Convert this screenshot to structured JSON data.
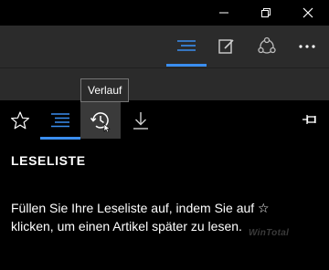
{
  "window_controls": {
    "minimize_icon": "minimize-icon",
    "restore_icon": "restore-icon",
    "close_icon": "close-icon"
  },
  "toolbar": {
    "buttons": [
      {
        "icon": "hub-icon",
        "active": true
      },
      {
        "icon": "web-note-icon",
        "active": false
      },
      {
        "icon": "share-icon",
        "active": false
      },
      {
        "icon": "more-icon",
        "active": false
      }
    ],
    "accent_color": "#3a8ef0"
  },
  "hub": {
    "tabs": [
      {
        "icon": "favorites-star-icon",
        "active": false
      },
      {
        "icon": "reading-list-icon",
        "active": true
      },
      {
        "icon": "history-icon",
        "active": false,
        "hovered": true
      },
      {
        "icon": "downloads-icon",
        "active": false
      }
    ],
    "pin_icon": "pin-icon",
    "tooltip": "Verlauf",
    "heading": "LESELISTE",
    "empty_message": "Füllen Sie Ihre Leseliste auf, indem Sie auf ☆ klicken, um einen Artikel später zu lesen."
  },
  "watermark": "WinTotal"
}
